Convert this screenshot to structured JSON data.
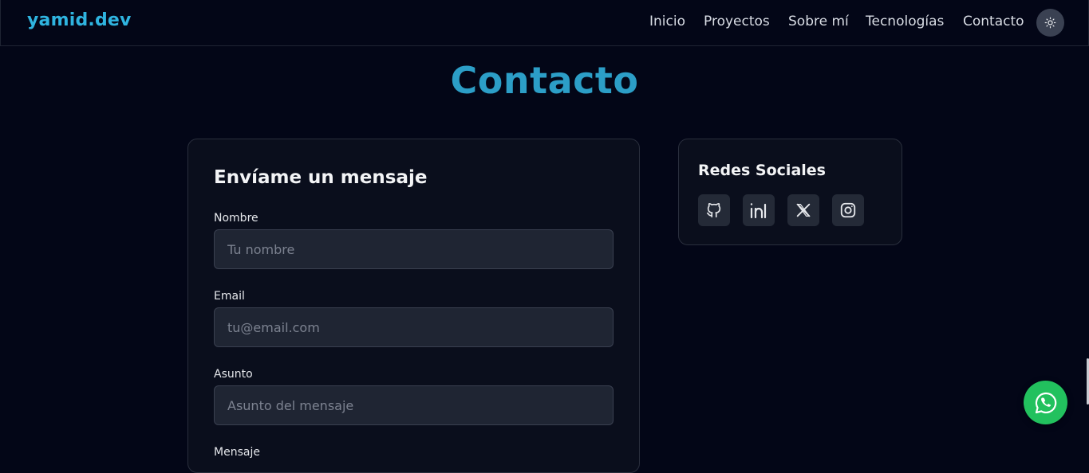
{
  "brand": {
    "logo": "yamid.dev",
    "accent": "#2fb4e0"
  },
  "nav": {
    "items": [
      {
        "label": "Inicio"
      },
      {
        "label": "Proyectos"
      },
      {
        "label": "Sobre mí"
      },
      {
        "label": "Tecnologías"
      },
      {
        "label": "Contacto"
      }
    ],
    "theme_toggle_icon": "sun-icon"
  },
  "section": {
    "title": "Contacto"
  },
  "form": {
    "title": "Envíame un mensaje",
    "fields": [
      {
        "label": "Nombre",
        "placeholder": "Tu nombre",
        "value": ""
      },
      {
        "label": "Email",
        "placeholder": "tu@email.com",
        "value": ""
      },
      {
        "label": "Asunto",
        "placeholder": "Asunto del mensaje",
        "value": ""
      },
      {
        "label": "Mensaje"
      }
    ]
  },
  "social": {
    "title": "Redes Sociales",
    "icons": [
      "github-icon",
      "linkedin-icon",
      "x-icon",
      "instagram-icon"
    ]
  },
  "whatsapp": {
    "icon": "whatsapp-icon",
    "color": "#22c15e"
  }
}
